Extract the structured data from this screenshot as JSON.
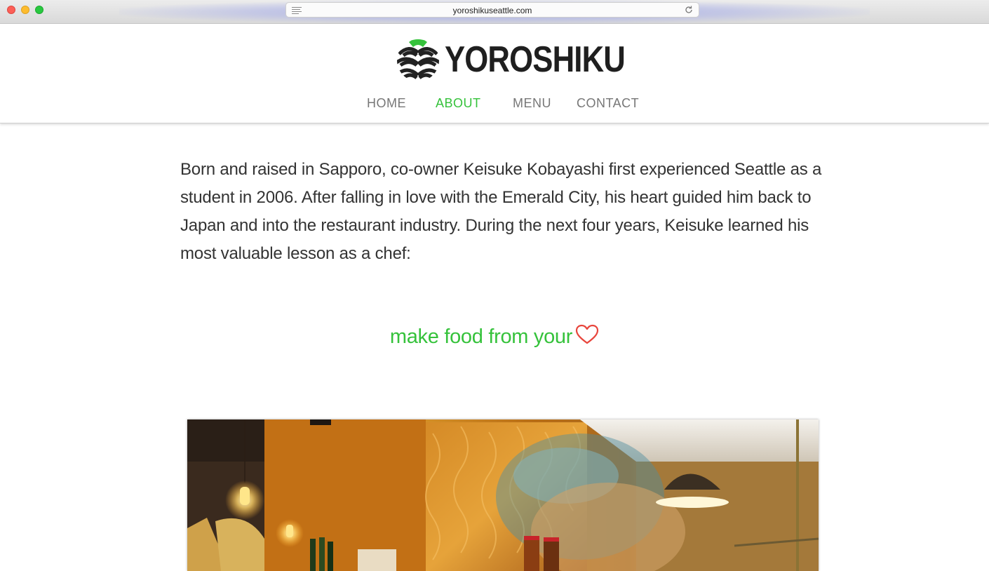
{
  "browser": {
    "url": "yoroshikuseattle.com"
  },
  "site": {
    "brand": "YOROSHIKU",
    "nav": [
      {
        "label": "HOME",
        "active": false
      },
      {
        "label": "ABOUT",
        "active": true
      },
      {
        "label": "MENU",
        "active": false
      },
      {
        "label": "CONTACT",
        "active": false
      }
    ]
  },
  "about": {
    "intro": "Born and raised in Sapporo, co-owner Keisuke Kobayashi first experienced Seattle as a student in 2006. After falling in love with the Emerald City, his heart guided him back to Japan and into the restaurant industry. During the next four years, Keisuke learned his most valuable lesson as a chef:",
    "tagline": "make food from your",
    "tagline_icon": "heart-outline-icon"
  },
  "colors": {
    "accent_green": "#35c23b",
    "heart_red": "#e8453c",
    "text": "#333333",
    "nav_text": "#777777"
  }
}
